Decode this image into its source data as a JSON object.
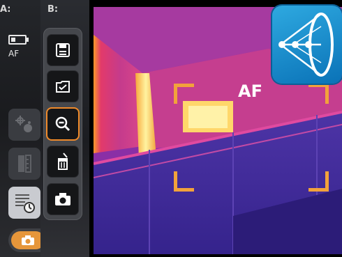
{
  "panel_a": {
    "label": "A:",
    "af_indicator": "AF"
  },
  "panel_b": {
    "label": "B:"
  },
  "viewfinder": {
    "af_label": "AF"
  },
  "colors": {
    "accent": "#f08a2a",
    "bracket": "#f2a23b",
    "logo": "#0a72b7"
  },
  "icons": {
    "battery": "battery-icon",
    "focus_points": "focus-points-icon",
    "ruler": "ruler-icon",
    "list_timer": "list-timer-icon",
    "save": "save-icon",
    "folder_check": "folder-check-icon",
    "zoom": "zoom-icon",
    "delete_shot": "trash-icon",
    "camera": "camera-icon",
    "play": "play-icon",
    "logo": "logo-icon"
  }
}
